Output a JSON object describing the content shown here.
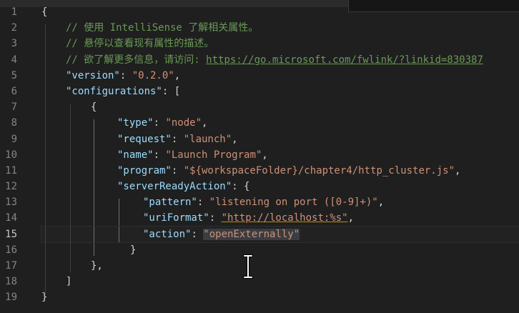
{
  "editor": {
    "active_line": 15,
    "line_numbers": [
      "1",
      "2",
      "3",
      "4",
      "5",
      "6",
      "7",
      "8",
      "9",
      "10",
      "11",
      "12",
      "13",
      "14",
      "15",
      "16",
      "17",
      "18",
      "19"
    ],
    "lines": {
      "l1_brace": "{",
      "l2_comment": "// 使用 IntelliSense 了解相关属性。",
      "l3_comment": "// 悬停以查看现有属性的描述。",
      "l4_comment_prefix": "// 欲了解更多信息，请访问: ",
      "l4_link": "https://go.microsoft.com/fwlink/?linkid=830387",
      "l5_key": "\"version\"",
      "l5_colon": ": ",
      "l5_value": "\"0.2.0\"",
      "l5_comma": ",",
      "l6_key": "\"configurations\"",
      "l6_rest": ": [",
      "l7_brace": "{",
      "l8_key": "\"type\"",
      "l8_colon": ": ",
      "l8_value": "\"node\"",
      "l8_comma": ",",
      "l9_key": "\"request\"",
      "l9_colon": ": ",
      "l9_value": "\"launch\"",
      "l9_comma": ",",
      "l10_key": "\"name\"",
      "l10_colon": ": ",
      "l10_value": "\"Launch Program\"",
      "l10_comma": ",",
      "l11_key": "\"program\"",
      "l11_colon": ": ",
      "l11_value": "\"${workspaceFolder}/chapter4/http_cluster.js\"",
      "l11_comma": ",",
      "l12_key": "\"serverReadyAction\"",
      "l12_rest": ": {",
      "l13_key": "\"pattern\"",
      "l13_colon": ": ",
      "l13_value": "\"listening on port ([0-9]+)\"",
      "l13_comma": ",",
      "l14_key": "\"uriFormat\"",
      "l14_colon": ": ",
      "l14_value": "\"http://localhost:%s\"",
      "l14_comma": ",",
      "l15_key": "\"action\"",
      "l15_colon": ": ",
      "l15_value": "\"openExternally\"",
      "l16_brace": "}",
      "l17_brace": "},",
      "l18_bracket": "]",
      "l19_brace": "}"
    }
  },
  "colors": {
    "background": "#1f1f1f",
    "comment": "#6a9955",
    "key": "#9cdcfe",
    "string": "#ce9178",
    "punctuation": "#d4d4d4",
    "line_number": "#858585"
  },
  "icons": {
    "cursor": "text-cursor-icon"
  }
}
